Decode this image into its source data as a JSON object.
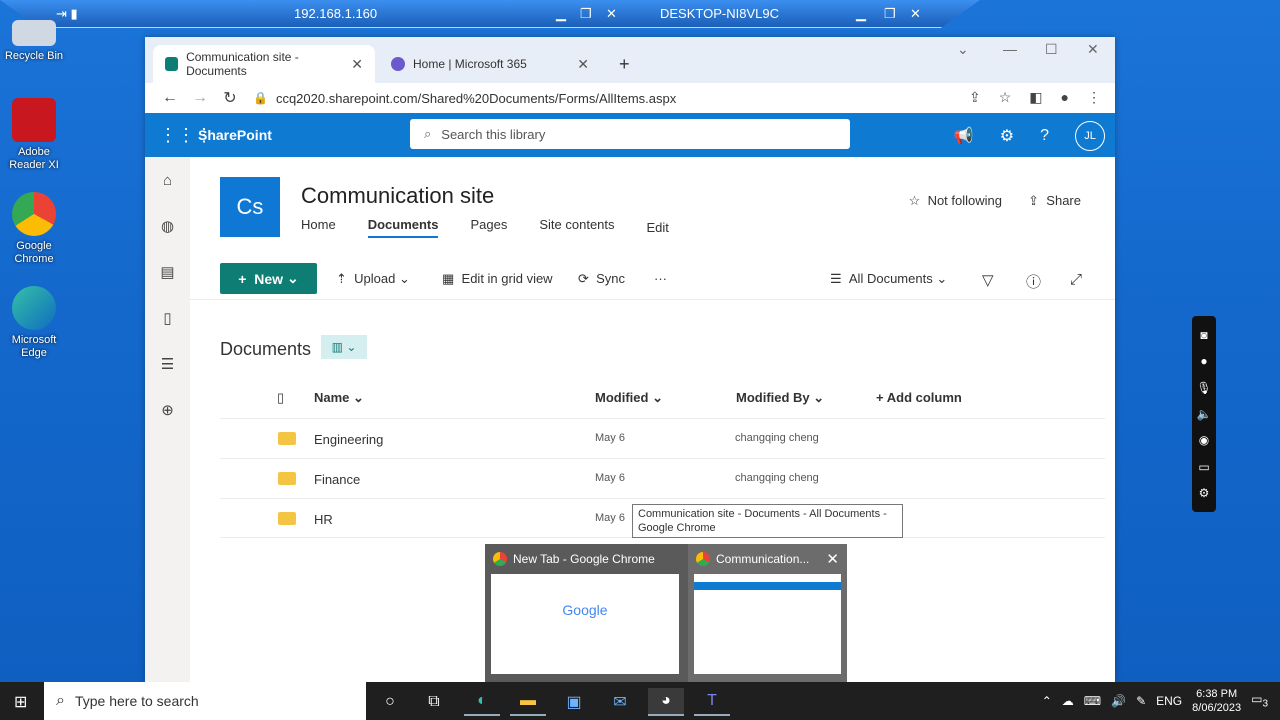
{
  "remote_bar": {
    "ip": "192.168.1.160",
    "host": "DESKTOP-NI8VL9C"
  },
  "desktop": {
    "icons": [
      {
        "label": "Recycle Bin"
      },
      {
        "label": "Adobe Reader XI"
      },
      {
        "label": "Google Chrome"
      },
      {
        "label": "Microsoft Edge"
      }
    ]
  },
  "browser": {
    "tabs": [
      {
        "title": "Communication site - Documents"
      },
      {
        "title": "Home | Microsoft 365"
      }
    ],
    "new_tab": "+",
    "url": "ccq2020.sharepoint.com/Shared%20Documents/Forms/AllItems.aspx"
  },
  "sharepoint": {
    "brand": "SharePoint",
    "search_placeholder": "Search this library",
    "user_initials": "JL",
    "site": {
      "logo": "Cs",
      "title": "Communication site",
      "nav": [
        "Home",
        "Documents",
        "Pages",
        "Site contents",
        "Edit"
      ],
      "follow": "Not following",
      "share": "Share"
    },
    "commands": {
      "new": "New",
      "upload": "Upload",
      "grid": "Edit in grid view",
      "sync": "Sync",
      "more": "···",
      "view": "All Documents"
    },
    "library": {
      "title": "Documents",
      "columns": {
        "name": "Name",
        "modified": "Modified",
        "modified_by": "Modified By",
        "add": "Add column"
      },
      "rows": [
        {
          "name": "Engineering",
          "modified": "May 6",
          "modified_by": "changqing cheng"
        },
        {
          "name": "Finance",
          "modified": "May 6",
          "modified_by": "changqing cheng"
        },
        {
          "name": "HR",
          "modified": "May 6",
          "modified_by": ""
        }
      ]
    }
  },
  "tooltip": "Communication site - Documents - All Documents - Google Chrome",
  "thumbnails": [
    {
      "title": "New Tab - Google Chrome",
      "preview_text": "Google"
    },
    {
      "title": "Communication..."
    }
  ],
  "taskbar": {
    "search_placeholder": "Type here to search",
    "lang": "ENG",
    "time": "6:38 PM",
    "date": "8/06/2023",
    "notif_count": "3"
  },
  "colors": {
    "sp_blue": "#0f7ad2",
    "teal": "#0e7d73",
    "desktop": "#1666c8"
  }
}
